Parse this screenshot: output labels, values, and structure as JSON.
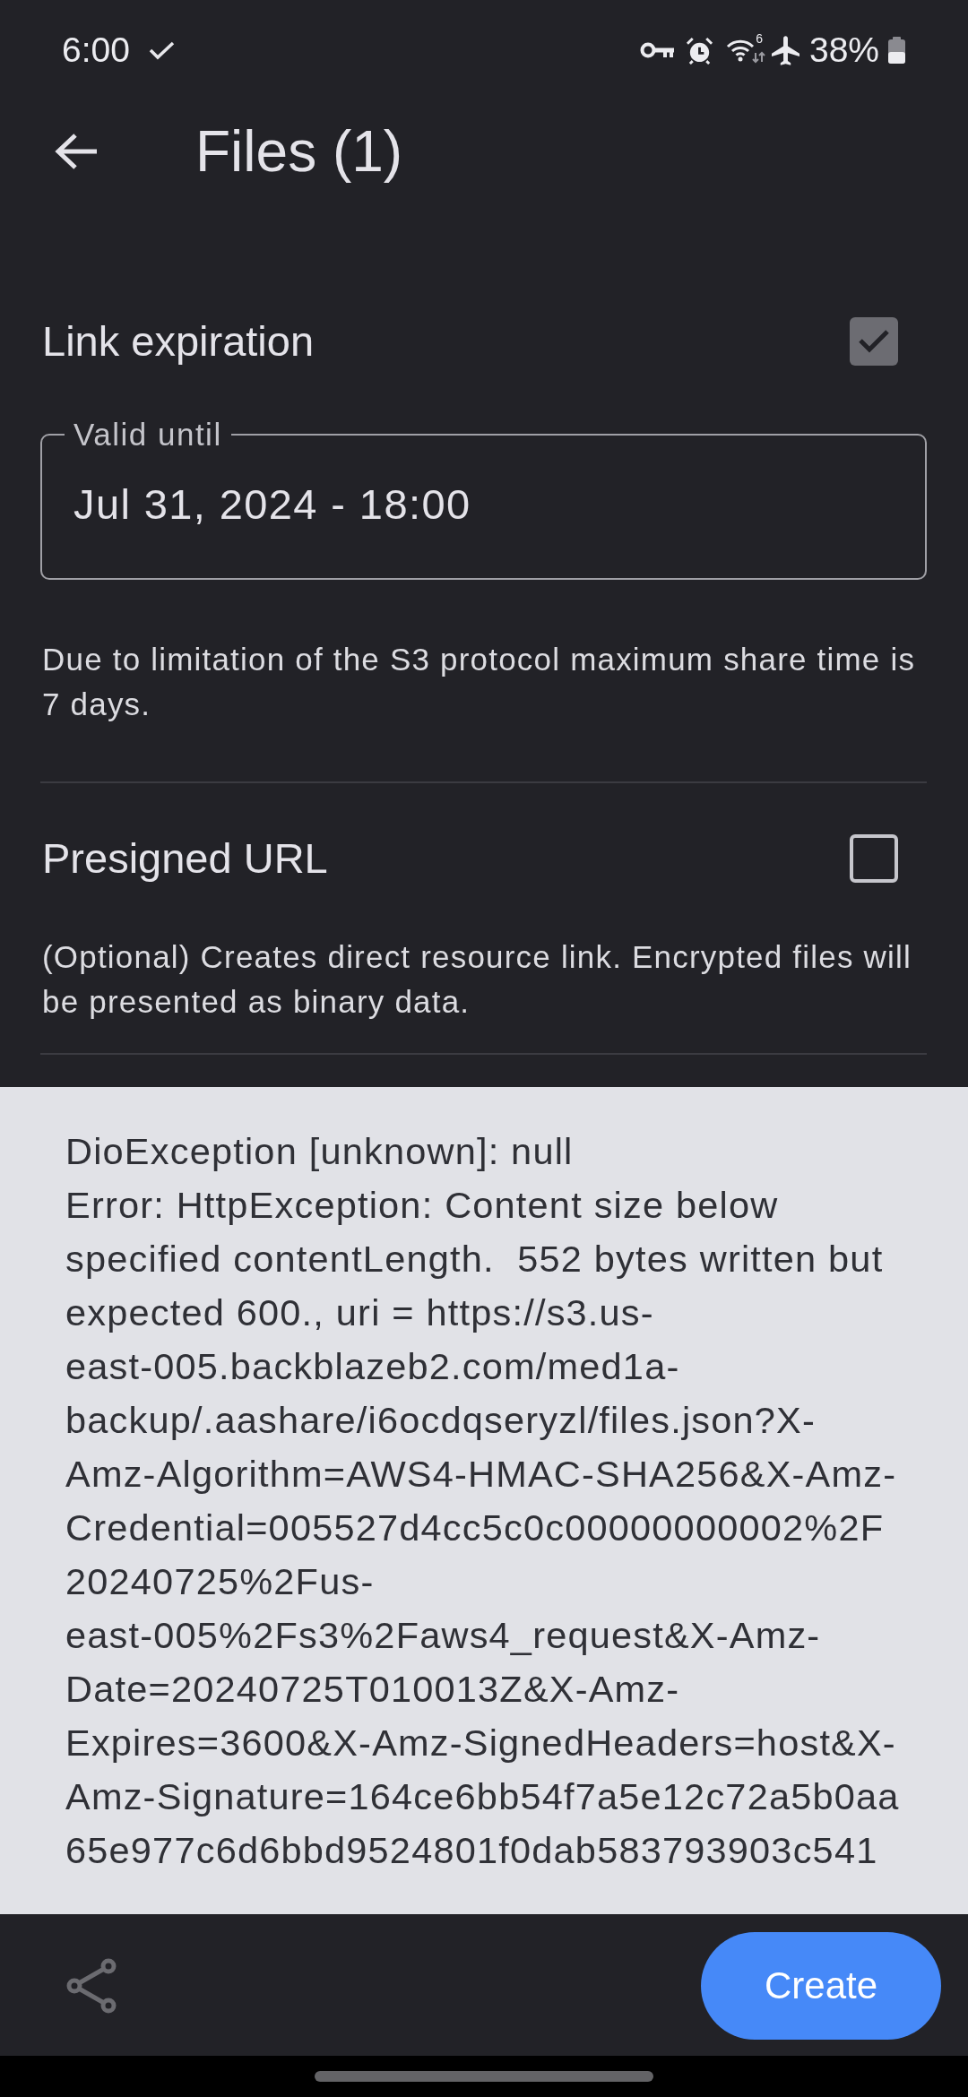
{
  "status_bar": {
    "time": "6:00",
    "wifi_badge": "6",
    "battery": "38%"
  },
  "app_bar": {
    "title": "Files (1)"
  },
  "options": [
    {
      "label": "Link expiration",
      "checked": true,
      "field": {
        "label": "Valid until",
        "value": "Jul 31, 2024 - 18:00"
      },
      "description": "Due to limitation of the S3 protocol maximum share time is 7 days."
    },
    {
      "label": "Presigned URL",
      "checked": false,
      "description": "(Optional) Creates direct resource link. Encrypted files will be presented as binary data."
    }
  ],
  "error_message": "DioException [unknown]: null\nError: HttpException: Content size below specified contentLength.  552 bytes written but expected 600., uri = https://s3.us-east-005.backblazeb2.com/med1a-backup/.aashare/i6ocdqseryzl/files.json?X-Amz-Algorithm=AWS4-HMAC-SHA256&X-Amz-Credential=005527d4cc5c0c00000000002%2F20240725%2Fus-east-005%2Fs3%2Faws4_request&X-Amz-Date=20240725T010013Z&X-Amz-Expires=3600&X-Amz-SignedHeaders=host&X-Amz-Signature=164ce6bb54f7a5e12c72a5b0aa65e977c6d6bbd9524801f0dab583793903c541",
  "bottom_bar": {
    "action": "Create"
  }
}
